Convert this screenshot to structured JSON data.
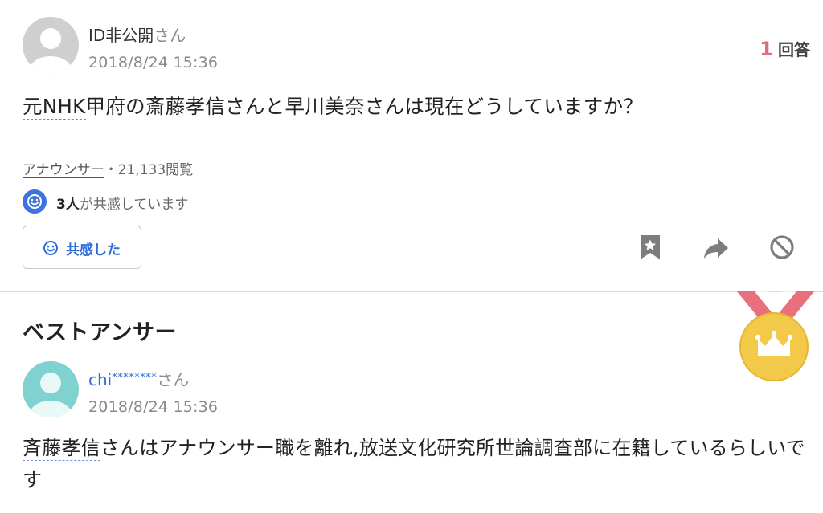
{
  "question": {
    "user": {
      "name": "ID非公開",
      "suffix": "さん"
    },
    "date": "2018/8/24 15:36",
    "answer_count": {
      "number": "1",
      "label": "回答"
    },
    "text_linked": "元NHK",
    "text_rest": "甲府の斎藤孝信さんと早川美奈さんは現在どうしていますか？",
    "category": "アナウンサー",
    "views": "・21,133閲覧",
    "empathy": {
      "count": "3人",
      "text": "が共感しています"
    },
    "empathy_button_label": "共感した"
  },
  "best_answer": {
    "section_title": "ベストアンサー",
    "user": {
      "name": "chi",
      "stars": "********",
      "suffix": "さん"
    },
    "date": "2018/8/24 15:36",
    "text_linked": "斉藤孝信",
    "text_rest": "さんはアナウンサー職を離れ,放送文化研究所世論調査部に在籍しているらしいです"
  },
  "icons": {
    "bookmark": "bookmark-star-icon",
    "share": "share-arrow-icon",
    "block": "block-circle-icon",
    "medal": "crown-medal-icon",
    "smile": "smile-face-icon"
  },
  "colors": {
    "link_blue": "#2d6bdb",
    "answer_count_red": "#e06a7a",
    "medal_gold": "#f3c94a",
    "ribbon_red": "#e7707c",
    "answerer_avatar": "#7fd2cf"
  }
}
